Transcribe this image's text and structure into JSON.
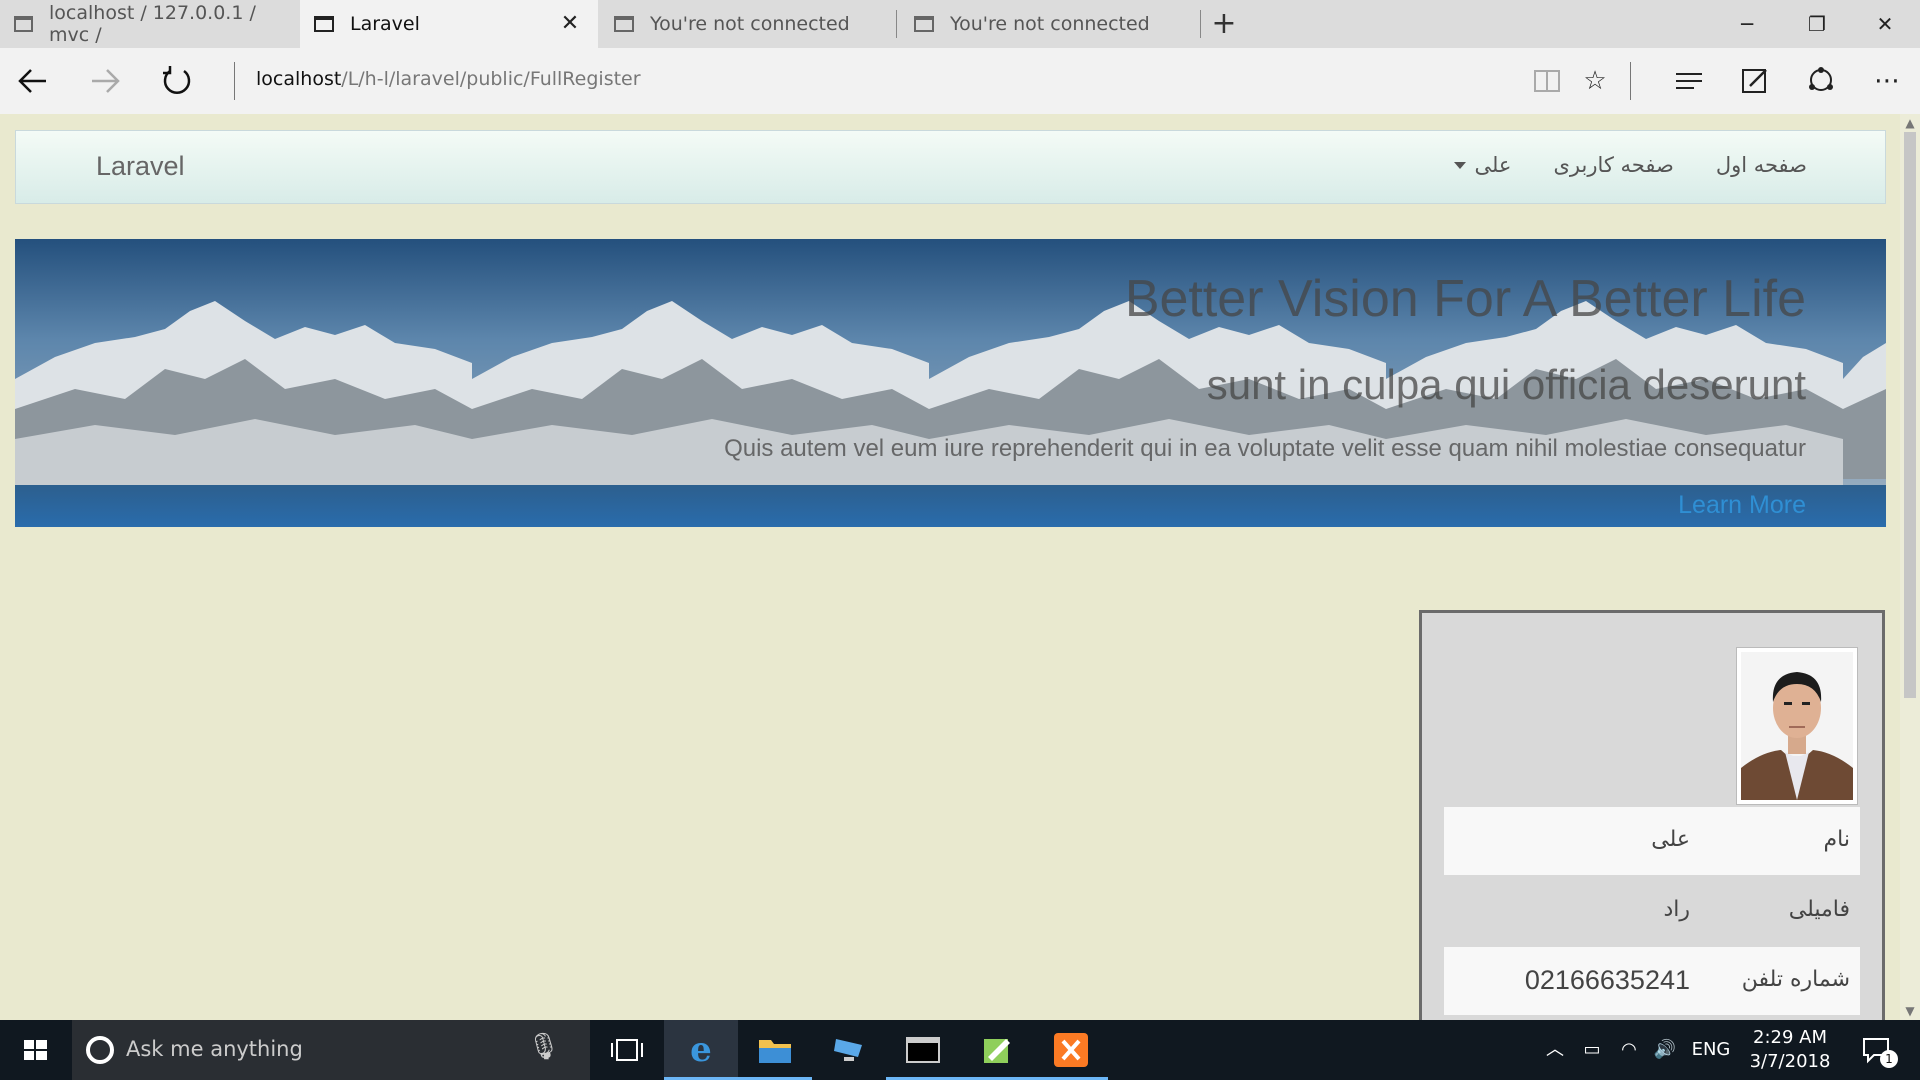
{
  "browser": {
    "tabs": [
      {
        "title": "localhost / 127.0.0.1 / mvc /",
        "active": false
      },
      {
        "title": "Laravel",
        "active": true
      },
      {
        "title": "You're not connected",
        "active": false
      },
      {
        "title": "You're not connected",
        "active": false
      }
    ],
    "url_host": "localhost",
    "url_path": "/L/h-l/laravel/public/FullRegister"
  },
  "navbar": {
    "brand": "Laravel",
    "links": [
      {
        "label": "صفحه اول"
      },
      {
        "label": "صفحه کاربری"
      },
      {
        "label": "علی",
        "dropdown": true
      }
    ]
  },
  "hero": {
    "title": "Better Vision For A Better Life",
    "subtitle": "sunt in culpa qui officia deserunt",
    "body": "Quis autem vel eum iure reprehenderit qui in ea voluptate velit esse quam nihil molestiae consequatur",
    "link": "Learn More"
  },
  "profile": {
    "rows": [
      {
        "label": "نام",
        "value": "علی"
      },
      {
        "label": "فامیلی",
        "value": "راد"
      },
      {
        "label": "شماره تلفن",
        "value": "02166635241"
      }
    ]
  },
  "taskbar": {
    "search_placeholder": "Ask me anything",
    "language": "ENG",
    "time": "2:29 AM",
    "date": "3/7/2018",
    "notification_count": "1"
  }
}
